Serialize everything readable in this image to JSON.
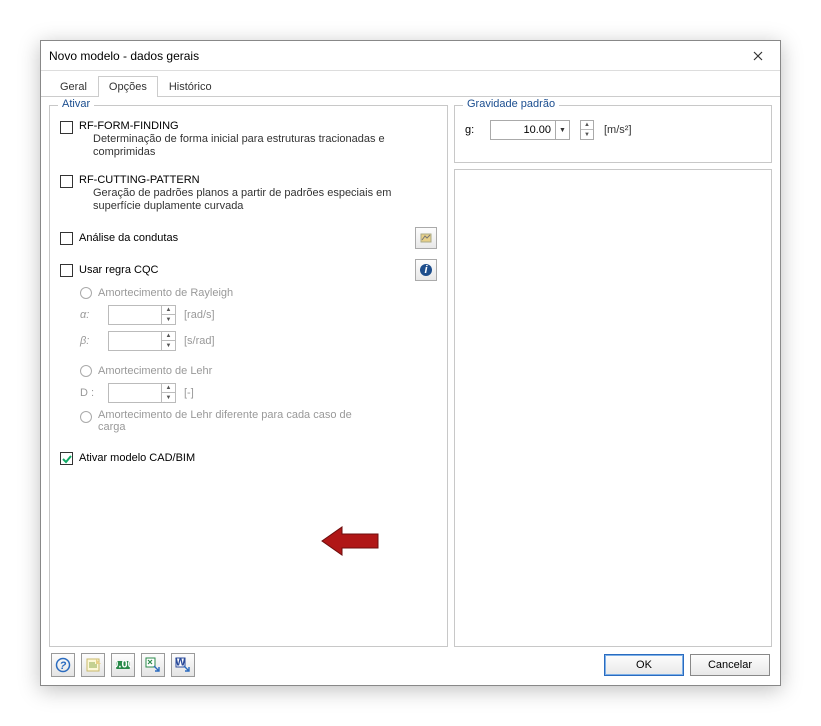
{
  "window": {
    "title": "Novo modelo - dados gerais"
  },
  "tabs": {
    "general": "Geral",
    "options": "Opções",
    "history": "Histórico"
  },
  "activate_group": {
    "title": "Ativar",
    "form_finding": {
      "label": "RF-FORM-FINDING",
      "desc": "Determinação de forma inicial para estruturas tracionadas e comprimidas"
    },
    "cutting_pattern": {
      "label": "RF-CUTTING-PATTERN",
      "desc": "Geração de padrões planos a partir de padrões especiais em superfície duplamente curvada"
    },
    "piping": {
      "label": "Análise da condutas"
    },
    "cqc": {
      "label": "Usar regra CQC"
    },
    "rayleigh": {
      "label": "Amortecimento de Rayleigh"
    },
    "alpha": {
      "label": "α:",
      "unit": "[rad/s]",
      "value": ""
    },
    "beta": {
      "label": "β:",
      "unit": "[s/rad]",
      "value": ""
    },
    "lehr": {
      "label": "Amortecimento de Lehr"
    },
    "d": {
      "label": "D :",
      "unit": "[-]",
      "value": ""
    },
    "lehr_per_case": {
      "label": "Amortecimento de Lehr diferente para cada caso de carga"
    },
    "cadbim": {
      "label": "Ativar modelo CAD/BIM"
    }
  },
  "gravity_group": {
    "title": "Gravidade padrão",
    "label": "g:",
    "value": "10.00",
    "unit": "[m/s²]"
  },
  "footer": {
    "ok": "OK",
    "cancel": "Cancelar"
  }
}
